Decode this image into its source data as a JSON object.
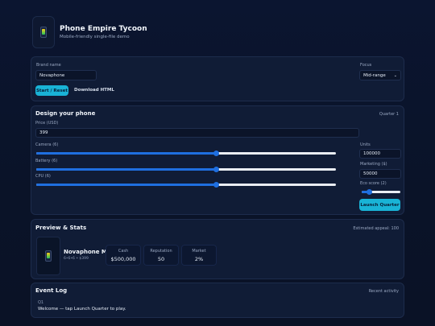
{
  "app": {
    "title": "Phone Empire Tycoon",
    "subtitle": "Mobile-friendly single-file demo"
  },
  "setup": {
    "brand_label": "Brand name",
    "brand_value": "Novaphone",
    "focus_label": "Focus",
    "focus_value": "Mid-range",
    "start_button": "Start / Reset",
    "download_button": "Download HTML"
  },
  "design": {
    "title": "Design your phone",
    "quarter": "Quarter 1",
    "price_label": "Price (USD)",
    "price_value": "399",
    "camera_label": "Camera (6)",
    "camera_level": 6,
    "battery_label": "Battery (6)",
    "battery_level": 6,
    "cpu_label": "CPU (6)",
    "cpu_level": 6,
    "slider_max": 10,
    "units_label": "Units",
    "units_value": "100000",
    "marketing_label": "Marketing ($)",
    "marketing_value": "50000",
    "eco_label": "Eco score (2)",
    "eco_level": 2,
    "launch_button": "Launch Quarter"
  },
  "preview": {
    "title": "Preview & Stats",
    "appeal": "Estimated appeal: 100",
    "phone_name": "Novaphone M",
    "phone_detail": "6•6•6 • $399",
    "stats": [
      {
        "label": "Cash",
        "value": "$500,000"
      },
      {
        "label": "Reputation",
        "value": "50"
      },
      {
        "label": "Market",
        "value": "2%"
      }
    ]
  },
  "log": {
    "title": "Event Log",
    "note": "Recent activity",
    "entry_quarter": "Q1",
    "entry_text": "Welcome — tap Launch Quarter to play."
  },
  "colors": {
    "accent": "#19b3d6",
    "slider": "#1f6fe0",
    "background": "#0b1530"
  }
}
